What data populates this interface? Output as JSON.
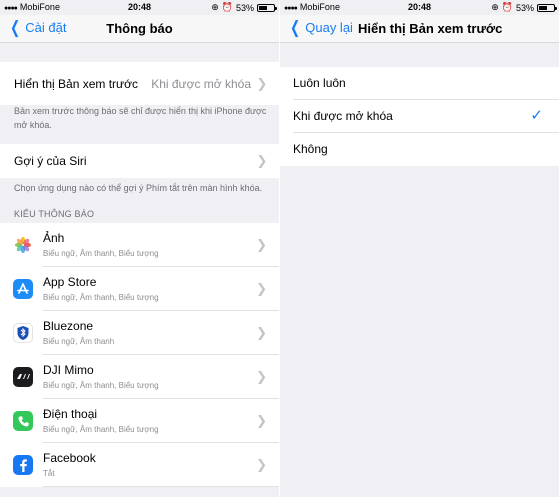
{
  "status_bar": {
    "carrier": "MobiFone",
    "time": "20:48",
    "battery": "53%",
    "battery_level": 0.53
  },
  "left": {
    "nav": {
      "back_label": "Cài đặt",
      "title": "Thông báo"
    },
    "preview_row": {
      "label": "Hiển thị Bản xem trước",
      "value": "Khi được mở khóa"
    },
    "preview_footer": "Bản xem trước thông báo sẽ chỉ được hiển thị khi iPhone được mở khóa.",
    "siri_row": {
      "label": "Gợi ý của Siri"
    },
    "siri_footer": "Chọn ứng dụng nào có thể gợi ý Phím tắt trên màn hình khóa.",
    "section_header": "KIỂU THÔNG BÁO",
    "apps": [
      {
        "name": "Ảnh",
        "subtitle": "Biểu ngữ, Âm thanh, Biểu tượng",
        "icon": "photos-icon"
      },
      {
        "name": "App Store",
        "subtitle": "Biểu ngữ, Âm thanh, Biểu tượng",
        "icon": "app-store-icon"
      },
      {
        "name": "Bluezone",
        "subtitle": "Biểu ngữ, Âm thanh",
        "icon": "bluezone-icon"
      },
      {
        "name": "DJI Mimo",
        "subtitle": "Biểu ngữ, Âm thanh, Biểu tượng",
        "icon": "dji-mimo-icon"
      },
      {
        "name": "Điện thoại",
        "subtitle": "Biểu ngữ, Âm thanh, Biểu tượng",
        "icon": "phone-icon"
      },
      {
        "name": "Facebook",
        "subtitle": "Tắt",
        "icon": "facebook-icon"
      }
    ]
  },
  "right": {
    "nav": {
      "back_label": "Quay lại",
      "title": "Hiển thị Bản xem trước"
    },
    "options": [
      {
        "label": "Luôn luôn",
        "selected": false
      },
      {
        "label": "Khi được mở khóa",
        "selected": true
      },
      {
        "label": "Không",
        "selected": false
      }
    ]
  },
  "colors": {
    "accent": "#1a7cf5",
    "background": "#efeff4",
    "secondary_text": "#8e8e93"
  }
}
